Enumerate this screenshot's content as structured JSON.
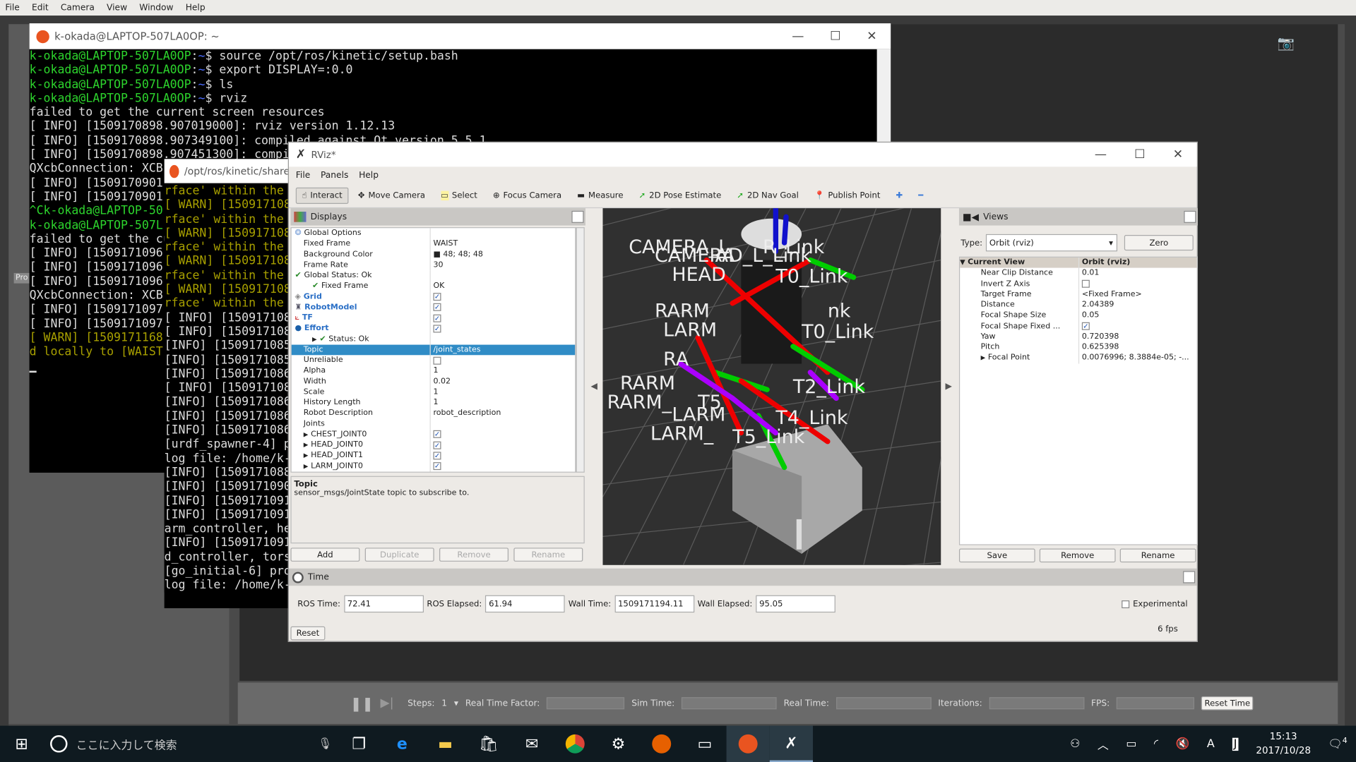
{
  "gazebo": {
    "menu": [
      "File",
      "Edit",
      "Camera",
      "View",
      "Window",
      "Help"
    ],
    "left_tab": "Pro",
    "toolbar": {
      "steps_label": "Steps:",
      "steps_value": "1",
      "real_time_factor": "Real Time Factor:",
      "sim_time": "Sim Time:",
      "real_time": "Real Time:",
      "iterations": "Iterations:",
      "fps": "FPS:",
      "reset_time": "Reset Time"
    }
  },
  "terminal1": {
    "title": "k-okada@LAPTOP-507LA0OP: ~",
    "lines": [
      {
        "p": "k-okada@LAPTOP-507LA0OP",
        "c": "$ source /opt/ros/kinetic/setup.bash"
      },
      {
        "p": "k-okada@LAPTOP-507LA0OP",
        "c": "$ export DISPLAY=:0.0"
      },
      {
        "p": "k-okada@LAPTOP-507LA0OP",
        "c": "$ ls"
      },
      {
        "p": "k-okada@LAPTOP-507LA0OP",
        "c": "$ rviz"
      },
      {
        "t": "failed to get the current screen resources"
      },
      {
        "t": "[ INFO] [1509170898.907019000]: rviz version 1.12.13"
      },
      {
        "t": "[ INFO] [1509170898.907349100]: compiled against Qt version 5.5.1"
      },
      {
        "t": "[ INFO] [1509170898.907451300]: compi"
      },
      {
        "t": "QXcbConnection: XCB"
      },
      {
        "t": "[ INFO] [1509170901"
      },
      {
        "t": "[ INFO] [1509170901"
      },
      {
        "t": ""
      },
      {
        "t": "^Ck-okada@LAPTOP-50",
        "g": true
      },
      {
        "t": "k-okada@LAPTOP-507L",
        "g": true
      },
      {
        "t": "failed to get the cu"
      },
      {
        "t": "[ INFO] [1509171096"
      },
      {
        "t": "[ INFO] [1509171096"
      },
      {
        "t": "[ INFO] [1509171096"
      },
      {
        "t": "QXcbConnection: XCB"
      },
      {
        "t": "[ INFO] [1509171097"
      },
      {
        "t": "[ INFO] [1509171097"
      },
      {
        "t": "[ WARN] [1509171168",
        "y": true
      },
      {
        "t": "d locally to [WAIST",
        "y": true
      }
    ]
  },
  "terminal2": {
    "title": "/opt/ros/kinetic/share",
    "lines": [
      {
        "t": "rface' within the",
        "y": true
      },
      {
        "t": "[ WARN] [150917108",
        "y": true
      },
      {
        "t": "rface' within the",
        "y": true
      },
      {
        "t": "[ WARN] [150917108",
        "y": true
      },
      {
        "t": "rface' within the",
        "y": true
      },
      {
        "t": "[ WARN] [150917108",
        "y": true
      },
      {
        "t": "rface' within the",
        "y": true
      },
      {
        "t": "[ WARN] [150917108",
        "y": true
      },
      {
        "t": "rface' within the",
        "y": true
      },
      {
        "t": "[ INFO] [150917108"
      },
      {
        "t": "[ INFO] [150917108"
      },
      {
        "t": "[INFO] [1509171085"
      },
      {
        "t": "[INFO] [1509171085"
      },
      {
        "t": "[INFO] [1509171086"
      },
      {
        "t": "[ INFO] [150917108"
      },
      {
        "t": "[INFO] [1509171086"
      },
      {
        "t": "[INFO] [1509171086"
      },
      {
        "t": "[INFO] [1509171086"
      },
      {
        "t": "[urdf_spawner-4] p"
      },
      {
        "t": "log file: /home/k-"
      },
      {
        "t": "[INFO] [1509171088"
      },
      {
        "t": "[INFO] [1509171090"
      },
      {
        "t": "[INFO] [1509171091"
      },
      {
        "t": "[INFO] [1509171091"
      },
      {
        "t": "arm_controller, he"
      },
      {
        "t": "[INFO] [1509171091"
      },
      {
        "t": "d_controller, tors"
      },
      {
        "t": "[go_initial-6] pro"
      },
      {
        "t": "log file: /home/k-"
      }
    ]
  },
  "rviz": {
    "title": "RViz*",
    "menu": [
      "File",
      "Panels",
      "Help"
    ],
    "tools": [
      {
        "label": "Interact",
        "icon": "hand-icon",
        "active": true
      },
      {
        "label": "Move Camera",
        "icon": "move-icon"
      },
      {
        "label": "Select",
        "icon": "select-icon"
      },
      {
        "label": "Focus Camera",
        "icon": "focus-icon"
      },
      {
        "label": "Measure",
        "icon": "ruler-icon"
      },
      {
        "label": "2D Pose Estimate",
        "icon": "arrow-green-icon"
      },
      {
        "label": "2D Nav Goal",
        "icon": "arrow-green-icon"
      },
      {
        "label": "Publish Point",
        "icon": "pin-icon"
      }
    ],
    "displays": {
      "title": "Displays",
      "rows": [
        {
          "k": "Global Options",
          "v": "",
          "ind": 1,
          "icon": "globe"
        },
        {
          "k": "Fixed Frame",
          "v": "WAIST",
          "ind": 2
        },
        {
          "k": "Background Color",
          "v": "■ 48; 48; 48",
          "ind": 2
        },
        {
          "k": "Frame Rate",
          "v": "30",
          "ind": 2
        },
        {
          "k": "Global Status: Ok",
          "v": "",
          "ind": 1,
          "icon": "check"
        },
        {
          "k": "Fixed Frame",
          "v": "OK",
          "ind": 3,
          "icon": "check"
        },
        {
          "k": "Grid",
          "v": "✓",
          "ind": 1,
          "blue": true,
          "cb": true,
          "icon": "grid"
        },
        {
          "k": "RobotModel",
          "v": "✓",
          "ind": 1,
          "blue": true,
          "cb": true,
          "icon": "robot"
        },
        {
          "k": "TF",
          "v": "✓",
          "ind": 1,
          "blue": true,
          "cb": true,
          "icon": "tf"
        },
        {
          "k": "Effort",
          "v": "✓",
          "ind": 1,
          "blue": true,
          "cb": true,
          "icon": "effort"
        },
        {
          "k": "Status: Ok",
          "v": "",
          "ind": 3,
          "icon": "check",
          "arrow": true
        },
        {
          "k": "Topic",
          "v": "/joint_states",
          "ind": 2,
          "sel": true
        },
        {
          "k": "Unreliable",
          "v": "",
          "ind": 2,
          "cb": true
        },
        {
          "k": "Alpha",
          "v": "1",
          "ind": 2
        },
        {
          "k": "Width",
          "v": "0.02",
          "ind": 2
        },
        {
          "k": "Scale",
          "v": "1",
          "ind": 2
        },
        {
          "k": "History Length",
          "v": "1",
          "ind": 2
        },
        {
          "k": "Robot Description",
          "v": "robot_description",
          "ind": 2
        },
        {
          "k": "Joints",
          "v": "",
          "ind": 2
        },
        {
          "k": "CHEST_JOINT0",
          "v": "✓",
          "ind": 2,
          "cb": true,
          "arrow": true
        },
        {
          "k": "HEAD_JOINT0",
          "v": "✓",
          "ind": 2,
          "cb": true,
          "arrow": true
        },
        {
          "k": "HEAD_JOINT1",
          "v": "✓",
          "ind": 2,
          "cb": true,
          "arrow": true
        },
        {
          "k": "LARM_JOINT0",
          "v": "✓",
          "ind": 2,
          "cb": true,
          "arrow": true
        }
      ],
      "desc_title": "Topic",
      "desc_text": "sensor_msgs/JointState topic to subscribe to.",
      "buttons": [
        "Add",
        "Duplicate",
        "Remove",
        "Rename"
      ]
    },
    "scene_labels": [
      "CAMERA_L",
      "R_Link",
      "CAMERA",
      "AD_L_Link",
      "HEAD",
      "T0_Link",
      "RARM",
      "nk",
      "LARM",
      "T0_Link",
      "RA",
      "RARM",
      "T2_Link",
      "RARM_",
      "T5",
      "LARM",
      "T4_Link",
      "LARM_",
      "T5_Link"
    ],
    "views": {
      "title": "Views",
      "type_label": "Type:",
      "type_value": "Orbit (rviz)",
      "zero": "Zero",
      "header": {
        "k": "Current View",
        "v": "Orbit (rviz)"
      },
      "rows": [
        {
          "k": "Near Clip Distance",
          "v": "0.01"
        },
        {
          "k": "Invert Z Axis",
          "v": "",
          "cb": true
        },
        {
          "k": "Target Frame",
          "v": "<Fixed Frame>"
        },
        {
          "k": "Distance",
          "v": "2.04389"
        },
        {
          "k": "Focal Shape Size",
          "v": "0.05"
        },
        {
          "k": "Focal Shape Fixed ...",
          "v": "✓",
          "cb": true
        },
        {
          "k": "Yaw",
          "v": "0.720398"
        },
        {
          "k": "Pitch",
          "v": "0.625398"
        },
        {
          "k": "Focal Point",
          "v": "0.0076996; 8.3884e-05; -...",
          "arrow": true
        }
      ],
      "buttons": [
        "Save",
        "Remove",
        "Rename"
      ]
    },
    "time": {
      "title": "Time",
      "ros_time_label": "ROS Time:",
      "ros_time": "72.41",
      "ros_elapsed_label": "ROS Elapsed:",
      "ros_elapsed": "61.94",
      "wall_time_label": "Wall Time:",
      "wall_time": "1509171194.11",
      "wall_elapsed_label": "Wall Elapsed:",
      "wall_elapsed": "95.05",
      "experimental": "Experimental",
      "reset": "Reset",
      "fps": "6 fps"
    }
  },
  "taskbar": {
    "search_placeholder": "ここに入力して検索",
    "time": "15:13",
    "date": "2017/10/28",
    "ime": "A",
    "notifications": "4"
  },
  "colors": {
    "terminal_prompt": "#2dd52d",
    "terminal_warn": "#a8a000",
    "selection": "#308cc6",
    "scene_bg": "#303030",
    "taskbar": "#0f1a20"
  }
}
